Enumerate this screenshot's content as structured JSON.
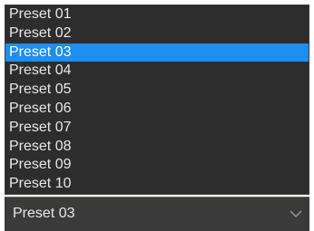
{
  "dropdown": {
    "options": [
      "Preset 01",
      "Preset 02",
      "Preset 03",
      "Preset 04",
      "Preset 05",
      "Preset 06",
      "Preset 07",
      "Preset 08",
      "Preset 09",
      "Preset 10"
    ],
    "selected_index": 2,
    "selected_value": "Preset 03",
    "icon": "chevron-down-icon"
  },
  "colors": {
    "list_background": "#2d2d2d",
    "highlight": "#1f8ef1",
    "field_background": "#3a3a3a",
    "text": "#e8e8e8"
  }
}
